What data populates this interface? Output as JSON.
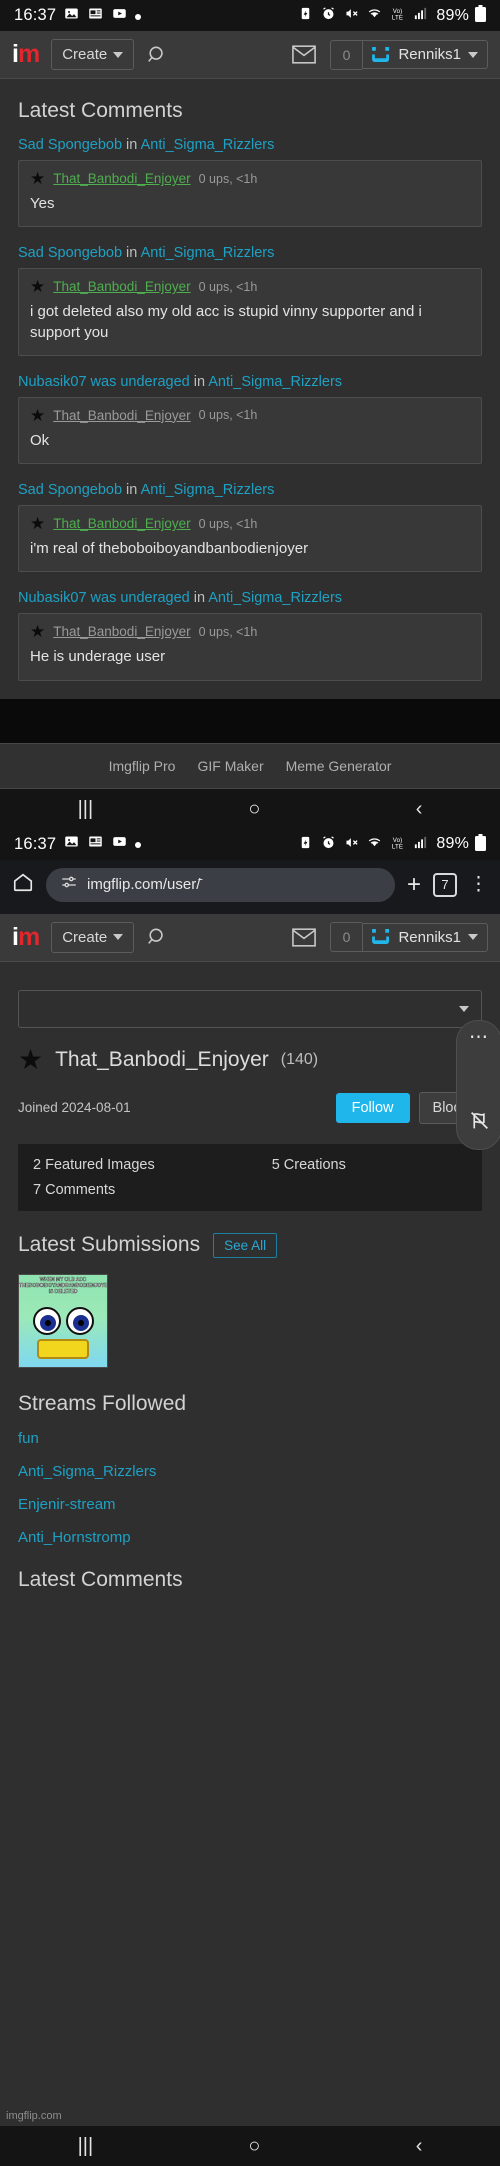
{
  "status_bar": {
    "time": "16:37",
    "left_icons": [
      "photo-icon",
      "news-icon",
      "youtube-icon",
      "dot-icon"
    ],
    "right_icons": [
      "battery-saver-icon",
      "alarm-icon",
      "mute-icon",
      "wifi-icon",
      "volte-icon",
      "signal-icon"
    ],
    "battery": "89%"
  },
  "imgflip_nav": {
    "logo_i": "i",
    "logo_m": "m",
    "create_label": "Create",
    "search_icon": "search-icon",
    "mail_icon": "mail-icon",
    "notification_count": "0",
    "username": "Renniks1"
  },
  "comments_page": {
    "title": "Latest Comments",
    "items": [
      {
        "post": "Sad Spongebob",
        "in": "in",
        "stream": "Anti_Sigma_Rizzlers",
        "author": "That_Banbodi_Enjoyer",
        "author_color": "green",
        "meta": "0 ups, <1h",
        "body": "Yes"
      },
      {
        "post": "Sad Spongebob",
        "in": "in",
        "stream": "Anti_Sigma_Rizzlers",
        "author": "That_Banbodi_Enjoyer",
        "author_color": "green",
        "meta": "0 ups, <1h",
        "body": "i got deleted also my old acc is stupid vinny supporter and i support you"
      },
      {
        "post": "Nubasik07 was underaged",
        "in": "in",
        "stream": "Anti_Sigma_Rizzlers",
        "author": "That_Banbodi_Enjoyer",
        "author_color": "gray",
        "meta": "0 ups, <1h",
        "body": "Ok"
      },
      {
        "post": "Sad Spongebob",
        "in": "in",
        "stream": "Anti_Sigma_Rizzlers",
        "author": "That_Banbodi_Enjoyer",
        "author_color": "green",
        "meta": "0 ups, <1h",
        "body": "i'm real of theboboiboyandbanbodienjoyer"
      },
      {
        "post": "Nubasik07 was underaged",
        "in": "in",
        "stream": "Anti_Sigma_Rizzlers",
        "author": "That_Banbodi_Enjoyer",
        "author_color": "gray",
        "meta": "0 ups, <1h",
        "body": "He is underage user"
      }
    ]
  },
  "footer": {
    "links": [
      "Imgflip Pro",
      "GIF Maker",
      "Meme Generator"
    ]
  },
  "android_nav": {
    "recents": "|||",
    "home": "○",
    "back": "‹"
  },
  "chrome_bar": {
    "home_icon": "home-icon",
    "site_settings_icon": "site-settings-icon",
    "url": "imgflip.com/user/̄",
    "new_tab": "+",
    "tab_count": "7",
    "menu_icon": "kebab-menu-icon"
  },
  "profile": {
    "dropdown_value": "",
    "star_icon": "star-icon",
    "name": "That_Banbodi_Enjoyer",
    "points": "(140)",
    "joined": "Joined 2024-08-01",
    "follow_label": "Follow",
    "block_label": "Block",
    "stats": {
      "featured_images": "2 Featured Images",
      "creations": "5 Creations",
      "comments": "7 Comments"
    },
    "side_pill": {
      "more_icon": "more-dots-icon",
      "flag_icon": "flag-off-icon"
    },
    "submissions": {
      "title": "Latest Submissions",
      "see_all": "See All",
      "thumb_caption": "WHEN MY OLD ACC THEBOBOIBOYANDBANBODIENJOYER IS DELETED"
    },
    "streams": {
      "title": "Streams Followed",
      "items": [
        "fun",
        "Anti_Sigma_Rizzlers",
        "Enjenir-stream",
        "Anti_Hornstromp"
      ]
    },
    "latest_comments_title": "Latest Comments"
  },
  "watermark": "imgflip.com",
  "colors": {
    "accent_blue": "#1ea1c4",
    "follow_blue": "#1fb6ec",
    "green_user": "#4fae4f",
    "logo_red": "#e1262c",
    "page_bg": "#2f2f2f"
  }
}
